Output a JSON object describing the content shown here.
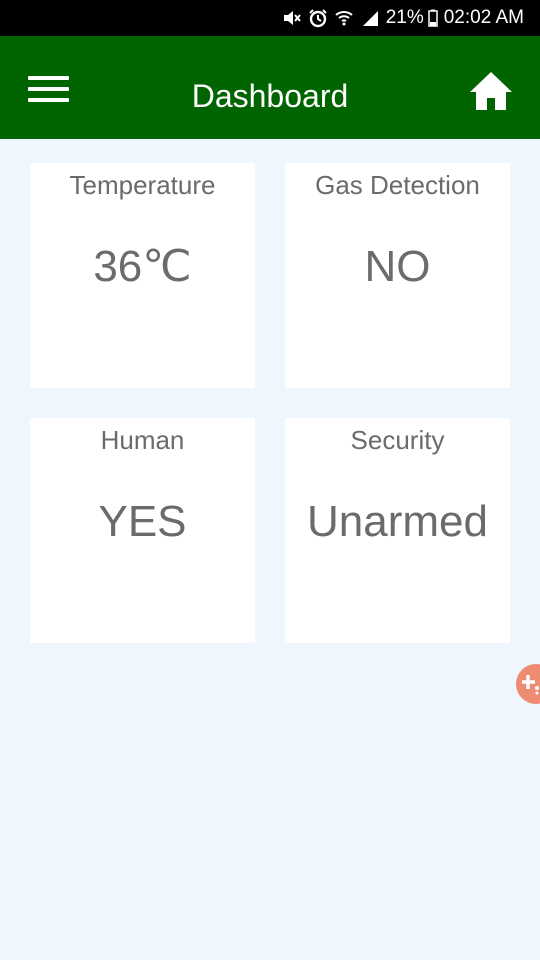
{
  "status_bar": {
    "icons": [
      "mute-icon",
      "alarm-icon",
      "wifi-icon",
      "signal-icon"
    ],
    "battery_percent": "21%",
    "time": "02:02 AM"
  },
  "app_bar": {
    "title": "Dashboard",
    "left_icon": "menu-icon",
    "right_icon": "home-icon"
  },
  "cards": [
    {
      "label": "Temperature",
      "value": "36℃"
    },
    {
      "label": "Gas Detection",
      "value": "NO"
    },
    {
      "label": "Human",
      "value": "YES"
    },
    {
      "label": "Security",
      "value": "Unarmed"
    }
  ],
  "fab": {
    "icon": "add-icon",
    "color": "#ee8b73"
  },
  "colors": {
    "app_bar": "#006400",
    "background": "#eff6fd",
    "card": "#ffffff",
    "text": "#6b6b6b"
  }
}
